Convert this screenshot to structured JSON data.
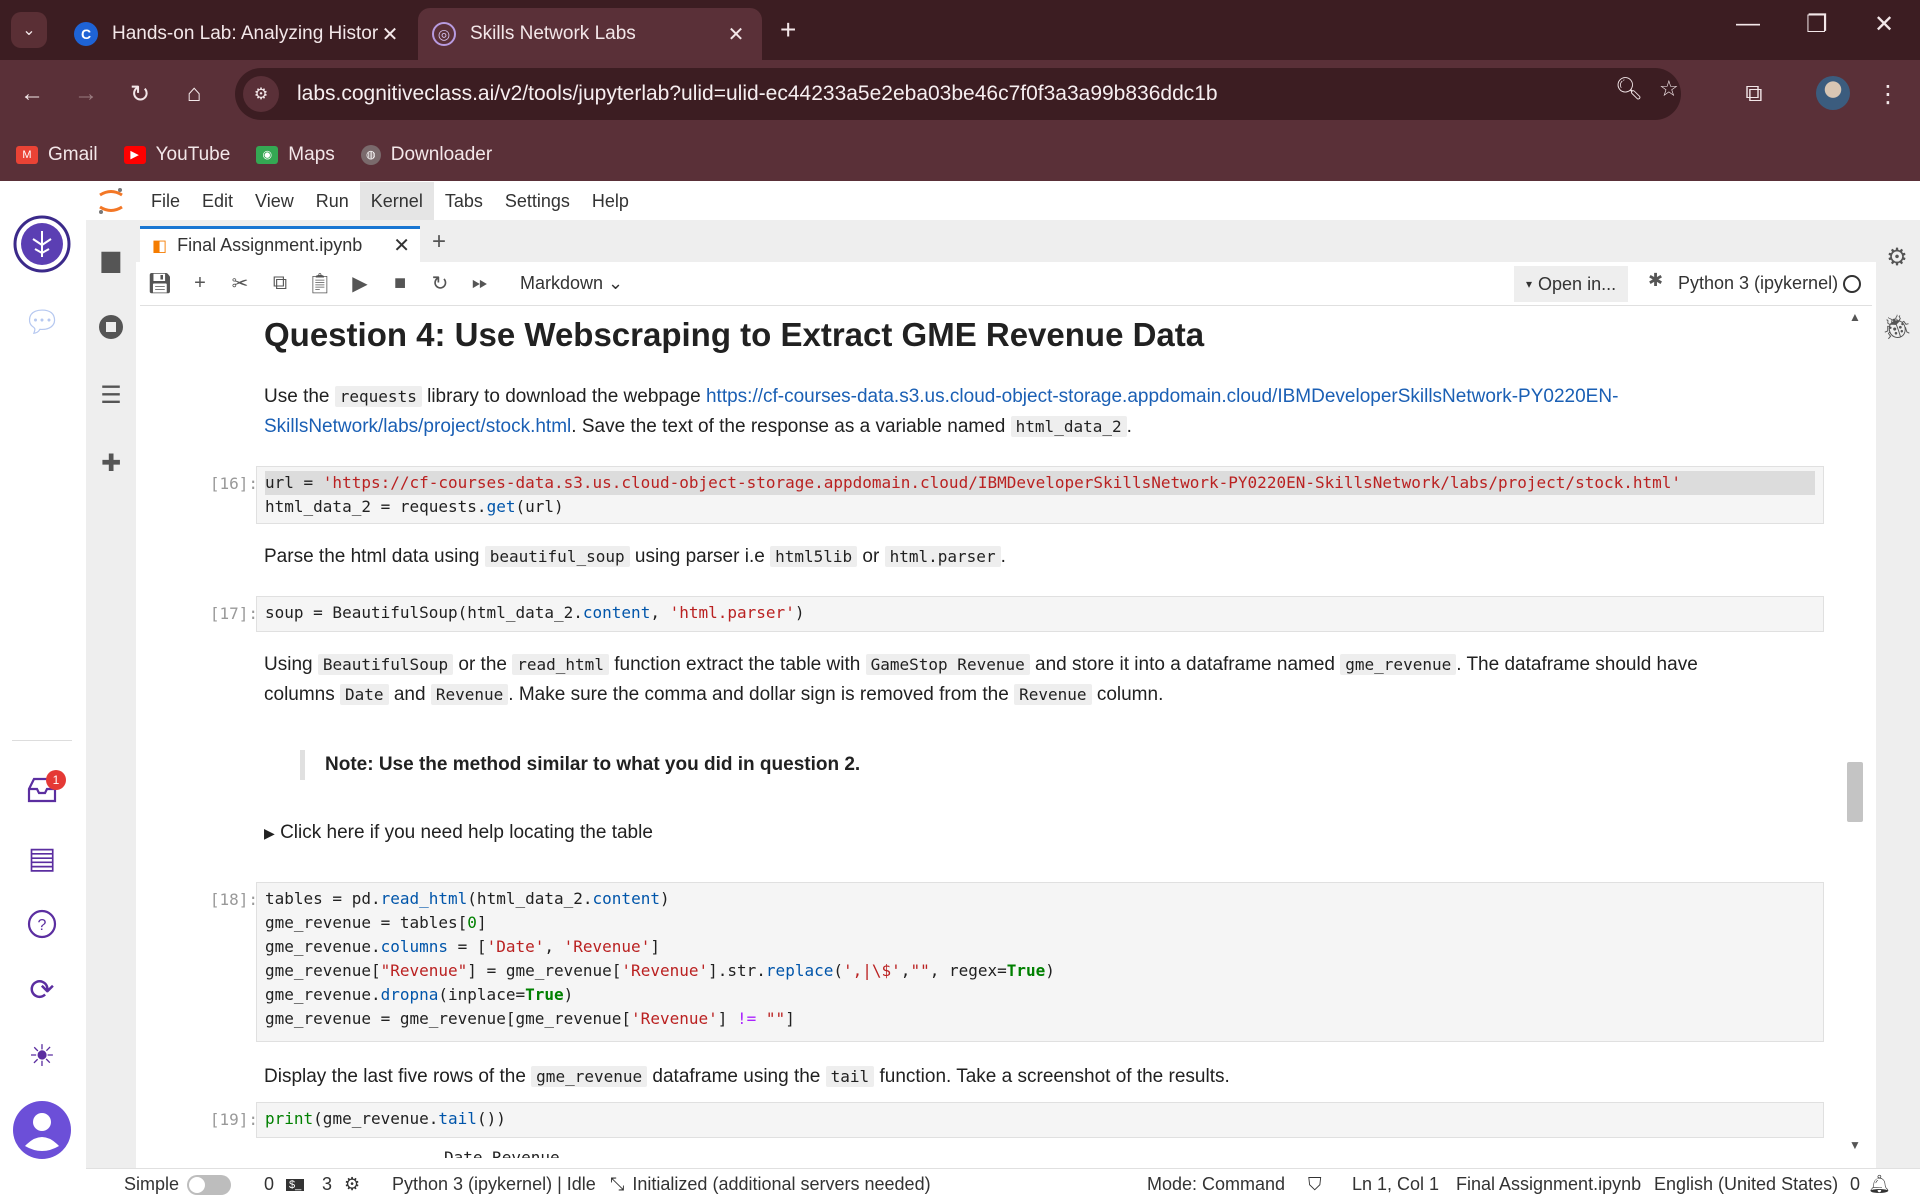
{
  "browser": {
    "tabs": [
      {
        "title": "Hands-on Lab: Analyzing Histor",
        "favicon": "C"
      },
      {
        "title": "Skills Network Labs",
        "favicon": "◎"
      }
    ],
    "url": "labs.cognitiveclass.ai/v2/tools/jupyterlab?ulid=ulid-ec44233a5e2eba03be46c7f0f3a3a99b836ddc1b",
    "bookmarks": [
      "Gmail",
      "YouTube",
      "Maps",
      "Downloader"
    ]
  },
  "menu": [
    "File",
    "Edit",
    "View",
    "Run",
    "Kernel",
    "Tabs",
    "Settings",
    "Help"
  ],
  "doc_tab": {
    "title": "Final Assignment.ipynb"
  },
  "toolbar": {
    "cell_type": "Markdown",
    "open_in": "Open in...",
    "kernel": "Python 3 (ipykernel)"
  },
  "notebook": {
    "heading": "Question 4: Use Webscraping to Extract GME Revenue Data",
    "p1": {
      "a": "Use the",
      "code1": "requests",
      "b": "library to download the webpage",
      "link": "https://cf-courses-data.s3.us.cloud-object-storage.appdomain.cloud/IBMDeveloperSkillsNetwork-PY0220EN-SkillsNetwork/labs/project/stock.html",
      "c": ". Save the text of the response as a variable named",
      "code2": "html_data_2",
      "d": "."
    },
    "cell16": {
      "prompt": "[16]:",
      "line1_a": "url = ",
      "line1_str": "'https://cf-courses-data.s3.us.cloud-object-storage.appdomain.cloud/IBMDeveloperSkillsNetwork-PY0220EN-SkillsNetwork/labs/project/stock.html'",
      "line2_a": "html_data_2 = requests.",
      "line2_fn": "get",
      "line2_b": "(url)"
    },
    "p2": {
      "a": "Parse the html data using",
      "code1": "beautiful_soup",
      "b": "using parser i.e",
      "code2": "html5lib",
      "c": "or",
      "code3": "html.parser",
      "d": "."
    },
    "cell17": {
      "prompt": "[17]:",
      "a": "soup = BeautifulSoup(html_data_2.",
      "attr": "content",
      "b": ", ",
      "str": "'html.parser'",
      "c": ")"
    },
    "p3": {
      "a": "Using",
      "code1": "BeautifulSoup",
      "b": "or the",
      "code2": "read_html",
      "c": "function extract the table with",
      "code3": "GameStop Revenue",
      "d": "and store it into a dataframe named",
      "code4": "gme_revenue",
      "e": ". The dataframe should have columns",
      "code5": "Date",
      "f": "and",
      "code6": "Revenue",
      "g": ". Make sure the comma and dollar sign is removed from the",
      "code7": "Revenue",
      "h": "column."
    },
    "note": "Note: Use the method similar to what you did in question 2.",
    "details": "Click here if you need help locating the table",
    "cell18": {
      "prompt": "[18]:",
      "l1_a": "tables = pd.",
      "l1_fn": "read_html",
      "l1_b": "(html_data_2.",
      "l1_attr": "content",
      "l1_c": ")",
      "l2_a": "gme_revenue = tables[",
      "l2_num": "0",
      "l2_b": "]",
      "l3_a": "gme_revenue.",
      "l3_attr": "columns",
      "l3_b": " = [",
      "l3_s1": "'Date'",
      "l3_c": ", ",
      "l3_s2": "'Revenue'",
      "l3_d": "]",
      "l4_a": "gme_revenue[",
      "l4_s1": "\"Revenue\"",
      "l4_b": "] = gme_revenue[",
      "l4_s2": "'Revenue'",
      "l4_c": "].str.",
      "l4_fn": "replace",
      "l4_d": "(",
      "l4_s3": "',|\\$'",
      "l4_e": ",",
      "l4_s4": "\"\"",
      "l4_f": ", regex=",
      "l4_kw": "True",
      "l4_g": ")",
      "l5_a": "gme_revenue.",
      "l5_fn": "dropna",
      "l5_b": "(inplace=",
      "l5_kw": "True",
      "l5_c": ")",
      "l6_a": "gme_revenue = gme_revenue[gme_revenue[",
      "l6_s1": "'Revenue'",
      "l6_b": "] ",
      "l6_op": "!=",
      "l6_c": " ",
      "l6_s2": "\"\"",
      "l6_d": "]"
    },
    "p4": {
      "a": "Display the last five rows of the",
      "code1": "gme_revenue",
      "b": "dataframe using the",
      "code2": "tail",
      "c": "function. Take a screenshot of the results."
    },
    "cell19": {
      "prompt": "[19]:",
      "fn": "print",
      "a": "(gme_revenue.",
      "attr": "tail",
      "b": "())"
    },
    "output19": "Date Revenue"
  },
  "left_badge": "1",
  "status": {
    "mode_label": "Simple",
    "count_a": "0",
    "count_b": "3",
    "kernel_status": "Python 3 (ipykernel) | Idle",
    "servers": "Initialized (additional servers needed)",
    "mode": "Mode: Command",
    "position": "Ln 1, Col 1",
    "file": "Final Assignment.ipynb",
    "language": "English (United States)",
    "notifications": "0"
  }
}
